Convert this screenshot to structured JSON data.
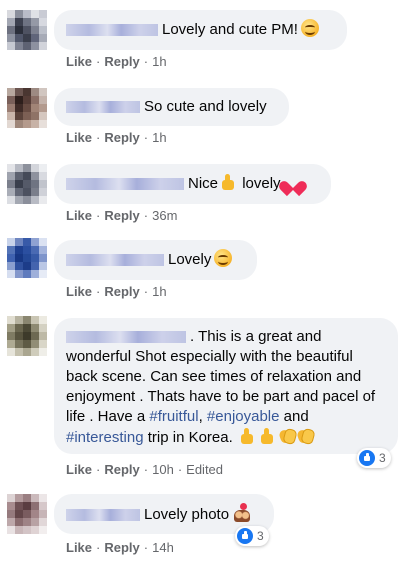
{
  "actions": {
    "like": "Like",
    "reply": "Reply",
    "separator": "·"
  },
  "comments": [
    {
      "text": "Lovely and cute PM!",
      "time": "1h"
    },
    {
      "text": "So cute and lovely",
      "time": "1h"
    },
    {
      "text_a": "Nice",
      "text_b": "lovely",
      "time": "36m"
    },
    {
      "text": "Lovely",
      "time": "1h"
    },
    {
      "text_a": ". This is a great and wonderful Shot especially with the beautiful back scene. Can see times of relaxation and enjoyment . Thats have to be part and pacel of life . Have a ",
      "hashtag_1": "#fruitful",
      "mid_1": ", ",
      "hashtag_2": "#enjoyable",
      "mid_2": " and ",
      "hashtag_3": "#interesting",
      "text_b": " trip in Korea.",
      "time": "10h",
      "edited": "Edited",
      "reactions": "3"
    },
    {
      "text": "Lovely photo",
      "time": "14h",
      "reactions": "3"
    }
  ],
  "colors": {
    "bubble": "#f0f2f5",
    "link": "#385898",
    "meta": "#65676b",
    "like_blue": "#1877f2"
  },
  "icons": [
    "avatar",
    "smile-emoji-icon",
    "thumbs-up-emoji-icon",
    "sparkling-heart-emoji-icon",
    "clapping-hands-emoji-icon",
    "couple-emoji-icon",
    "like-reaction-icon"
  ]
}
